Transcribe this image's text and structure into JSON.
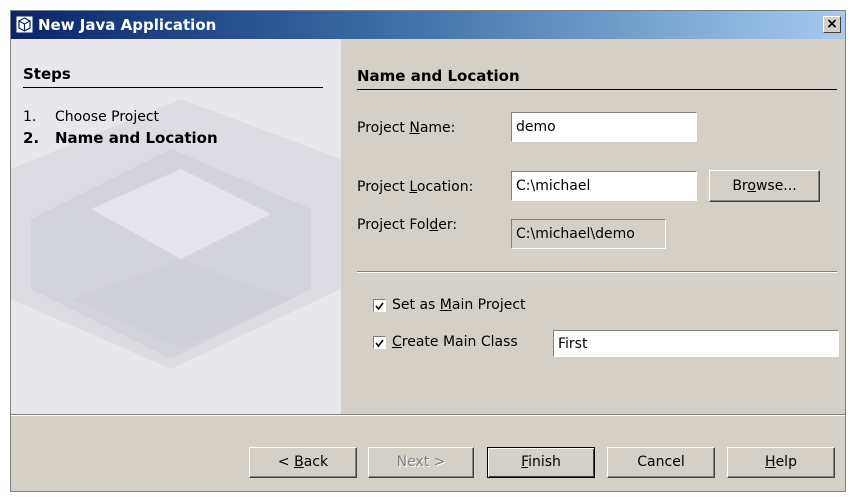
{
  "window": {
    "title": "New Java Application",
    "close_label": "×"
  },
  "steps": {
    "title": "Steps",
    "items": [
      {
        "number": "1.",
        "label": "Choose Project"
      },
      {
        "number": "2.",
        "label": "Name and Location"
      }
    ]
  },
  "section": {
    "title": "Name and Location",
    "project_name": {
      "label_pre": "Project ",
      "label_key": "N",
      "label_post": "ame:",
      "value": "demo"
    },
    "project_location": {
      "label_pre": "Project ",
      "label_key": "L",
      "label_post": "ocation:",
      "value": "C:\\michael"
    },
    "project_folder": {
      "label_pre": "Project Fol",
      "label_key": "d",
      "label_post": "er:",
      "value": "C:\\michael\\demo"
    },
    "browse": {
      "pre": "Br",
      "key": "o",
      "post": "wse..."
    },
    "set_main": {
      "pre": "Set as ",
      "key": "M",
      "post": "ain Project",
      "checked": true
    },
    "create_main": {
      "pre": "",
      "key": "C",
      "post": "reate Main Class",
      "checked": true,
      "value": "First"
    }
  },
  "buttons": {
    "back": {
      "pre": "< ",
      "key": "B",
      "post": "ack"
    },
    "next": {
      "pre": "",
      "key": "",
      "post": "Next >"
    },
    "finish": {
      "pre": "",
      "key": "F",
      "post": "inish"
    },
    "cancel": {
      "pre": "",
      "key": "",
      "post": "Cancel"
    },
    "help": {
      "pre": "",
      "key": "H",
      "post": "elp"
    }
  }
}
